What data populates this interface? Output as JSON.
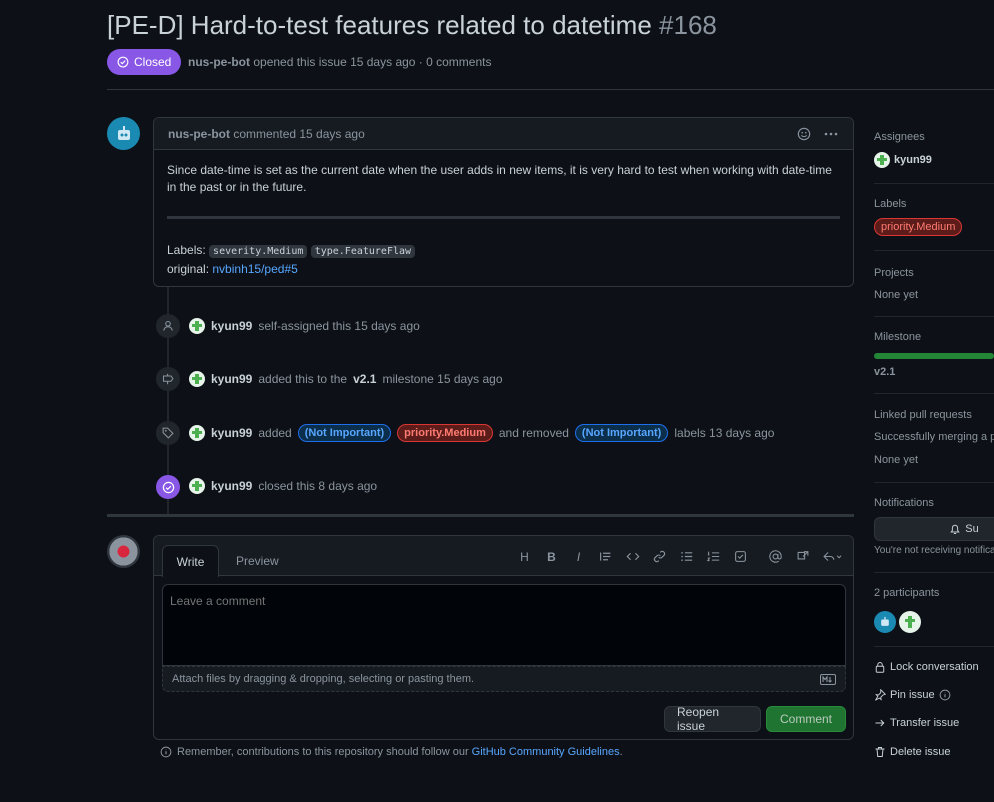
{
  "issue": {
    "title": "[PE-D] Hard-to-test features related to datetime",
    "number": "#168",
    "state": "Closed",
    "author": "nus-pe-bot",
    "meta_rest": "opened this issue 15 days ago · 0 comments"
  },
  "comment": {
    "author": "nus-pe-bot",
    "action": "commented 15 days ago",
    "body": "Since date-time is set as the current date when the user adds in new items, it is very hard to test when working with date-time in the past or in the future.",
    "labels_prefix": "Labels:",
    "label1": "severity.Medium",
    "label2": "type.FeatureFlaw",
    "original_prefix": "original:",
    "original_link": "nvbinh15/ped#5"
  },
  "timeline": {
    "event1": {
      "user": "kyun99",
      "text": "self-assigned this 15 days ago"
    },
    "event2": {
      "user": "kyun99",
      "text_a": "added this to the",
      "milestone": "v2.1",
      "text_b": "milestone 15 days ago"
    },
    "event3": {
      "user": "kyun99",
      "added": "added",
      "pill1": "(Not Important)",
      "pill2": "priority.Medium",
      "removed": "and removed",
      "pill3": "(Not Important)",
      "tail": "labels 13 days ago"
    },
    "event4": {
      "user": "kyun99",
      "text": "closed this 8 days ago"
    }
  },
  "form": {
    "tab_write": "Write",
    "tab_preview": "Preview",
    "placeholder": "Leave a comment",
    "attach": "Attach files by dragging & dropping, selecting or pasting them.",
    "reopen": "Reopen issue",
    "comment": "Comment",
    "toolbar": [
      "H",
      "B",
      "I"
    ],
    "guidelines_prefix": "Remember, contributions to this repository should follow our",
    "guidelines_link": "GitHub Community Guidelines",
    "guidelines_suffix": "."
  },
  "sidebar": {
    "assignees_h": "Assignees",
    "assignee": "kyun99",
    "labels_h": "Labels",
    "label": "priority.Medium",
    "projects_h": "Projects",
    "projects_v": "None yet",
    "milestone_h": "Milestone",
    "milestone_v": "v2.1",
    "milestone_progress": 1.0,
    "linked_h": "Linked pull requests",
    "linked_desc": "Successfully merging a pull",
    "linked_v": "None yet",
    "notifications_h": "Notifications",
    "subscribe": "Su",
    "notif_desc": "You're not receiving notifica",
    "participants_h": "2 participants",
    "lock": "Lock conversation",
    "pin": "Pin issue",
    "transfer": "Transfer issue",
    "delete": "Delete issue"
  },
  "colors": {
    "closed": "#8957e5",
    "accent": "#58a6ff",
    "green": "#238636",
    "danger": "#da3633"
  }
}
